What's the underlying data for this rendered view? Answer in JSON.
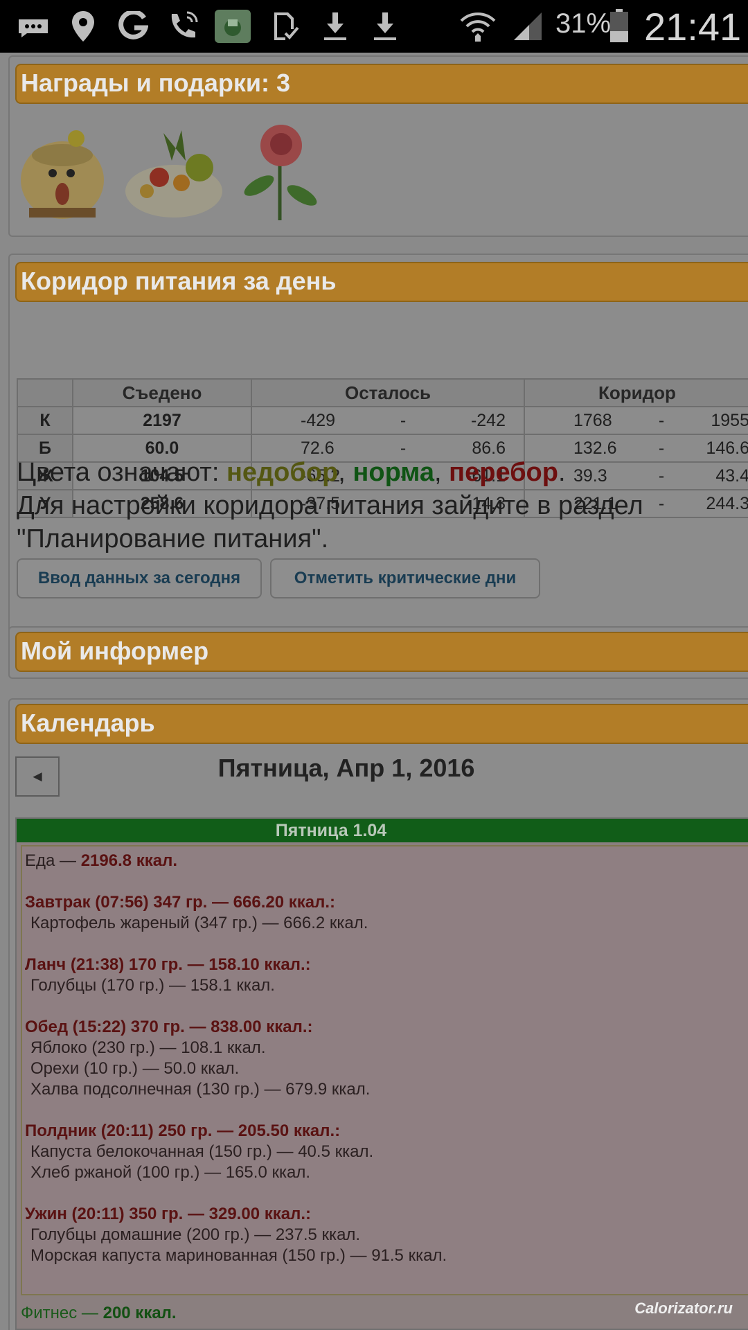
{
  "status_bar": {
    "icons": [
      "more-icon",
      "location-icon",
      "g-icon",
      "wifi-calling-icon",
      "app-icon",
      "sim-icon",
      "download-icon",
      "download-icon",
      "wifi-icon",
      "signal-icon",
      "battery-icon"
    ],
    "battery": "31%",
    "time": "21:41"
  },
  "awards": {
    "title": "Награды и подарки: 3",
    "gifts": [
      "straw-doll-image",
      "fruit-salad-image",
      "rose-image"
    ]
  },
  "corridor": {
    "title": "Коридор питания за день",
    "columns": [
      "",
      "Съедено",
      "Осталось",
      "Коридор"
    ],
    "rows": [
      {
        "label": "К",
        "eaten": "2197",
        "eaten_status": "over",
        "left_from": "-429",
        "left_to": "-242",
        "corr_from": "1768",
        "corr_to": "1955"
      },
      {
        "label": "Б",
        "eaten": "60.0",
        "eaten_status": "under",
        "left_from": "72.6",
        "left_to": "86.6",
        "corr_from": "132.6",
        "corr_to": "146.6"
      },
      {
        "label": "Ж",
        "eaten": "104.5",
        "eaten_status": "over",
        "left_from": "-65.2",
        "left_to": "-61.1",
        "corr_from": "39.3",
        "corr_to": "43.4"
      },
      {
        "label": "У",
        "eaten": "258.6",
        "eaten_status": "over",
        "left_from": "-37.5",
        "left_to": "-14.3",
        "corr_from": "221.1",
        "corr_to": "244.3"
      }
    ],
    "dash": "-",
    "legend_prefix": "Цвета означают:",
    "legend_under": "недобор",
    "legend_norm": "норма",
    "legend_over": "перебор",
    "note": "Для настройки коридора питания зайдите в раздел \"Планирование питания\".",
    "button_today": "Ввод данных за сегодня",
    "button_critical": "Отметить критические дни",
    "colors": {
      "under": "#545712",
      "norm": "#0f5414",
      "over": "#6d0f0f"
    }
  },
  "informer": {
    "title": "Мой информер"
  },
  "calendar": {
    "title": "Календарь",
    "prev_label": "◄",
    "date": "Пятница, Апр 1, 2016",
    "day_header": "Пятница 1.04",
    "food_prefix": "Еда — ",
    "food_total": "2196.8 ккал.",
    "meals": [
      {
        "title": "Завтрак (07:56) 347 гр. — 666.20 ккал.:",
        "items": [
          "Картофель жареный (347 гр.) — 666.2 ккал."
        ]
      },
      {
        "title": "Ланч (21:38) 170 гр. — 158.10 ккал.:",
        "items": [
          "Голубцы (170 гр.) — 158.1 ккал."
        ]
      },
      {
        "title": "Обед (15:22) 370 гр. — 838.00 ккал.:",
        "items": [
          "Яблоко (230 гр.) — 108.1 ккал.",
          "Орехи (10 гр.) — 50.0 ккал.",
          "Халва подсолнечная (130 гр.) — 679.9 ккал."
        ]
      },
      {
        "title": "Полдник (20:11) 250 гр. — 205.50 ккал.:",
        "items": [
          "Капуста белокочанная (150 гр.) — 40.5 ккал.",
          "Хлеб ржаной (100 гр.) — 165.0 ккал."
        ]
      },
      {
        "title": "Ужин (20:11) 350 гр. — 329.00 ккал.:",
        "items": [
          "Голубцы домашние (200 гр.) — 237.5 ккал.",
          "Морская капуста маринованная (150 гр.) — 91.5 ккал."
        ]
      }
    ],
    "fitness_prefix": "Фитнес — ",
    "fitness_total": "200 ккал."
  },
  "watermark": "Calorizator.ru"
}
